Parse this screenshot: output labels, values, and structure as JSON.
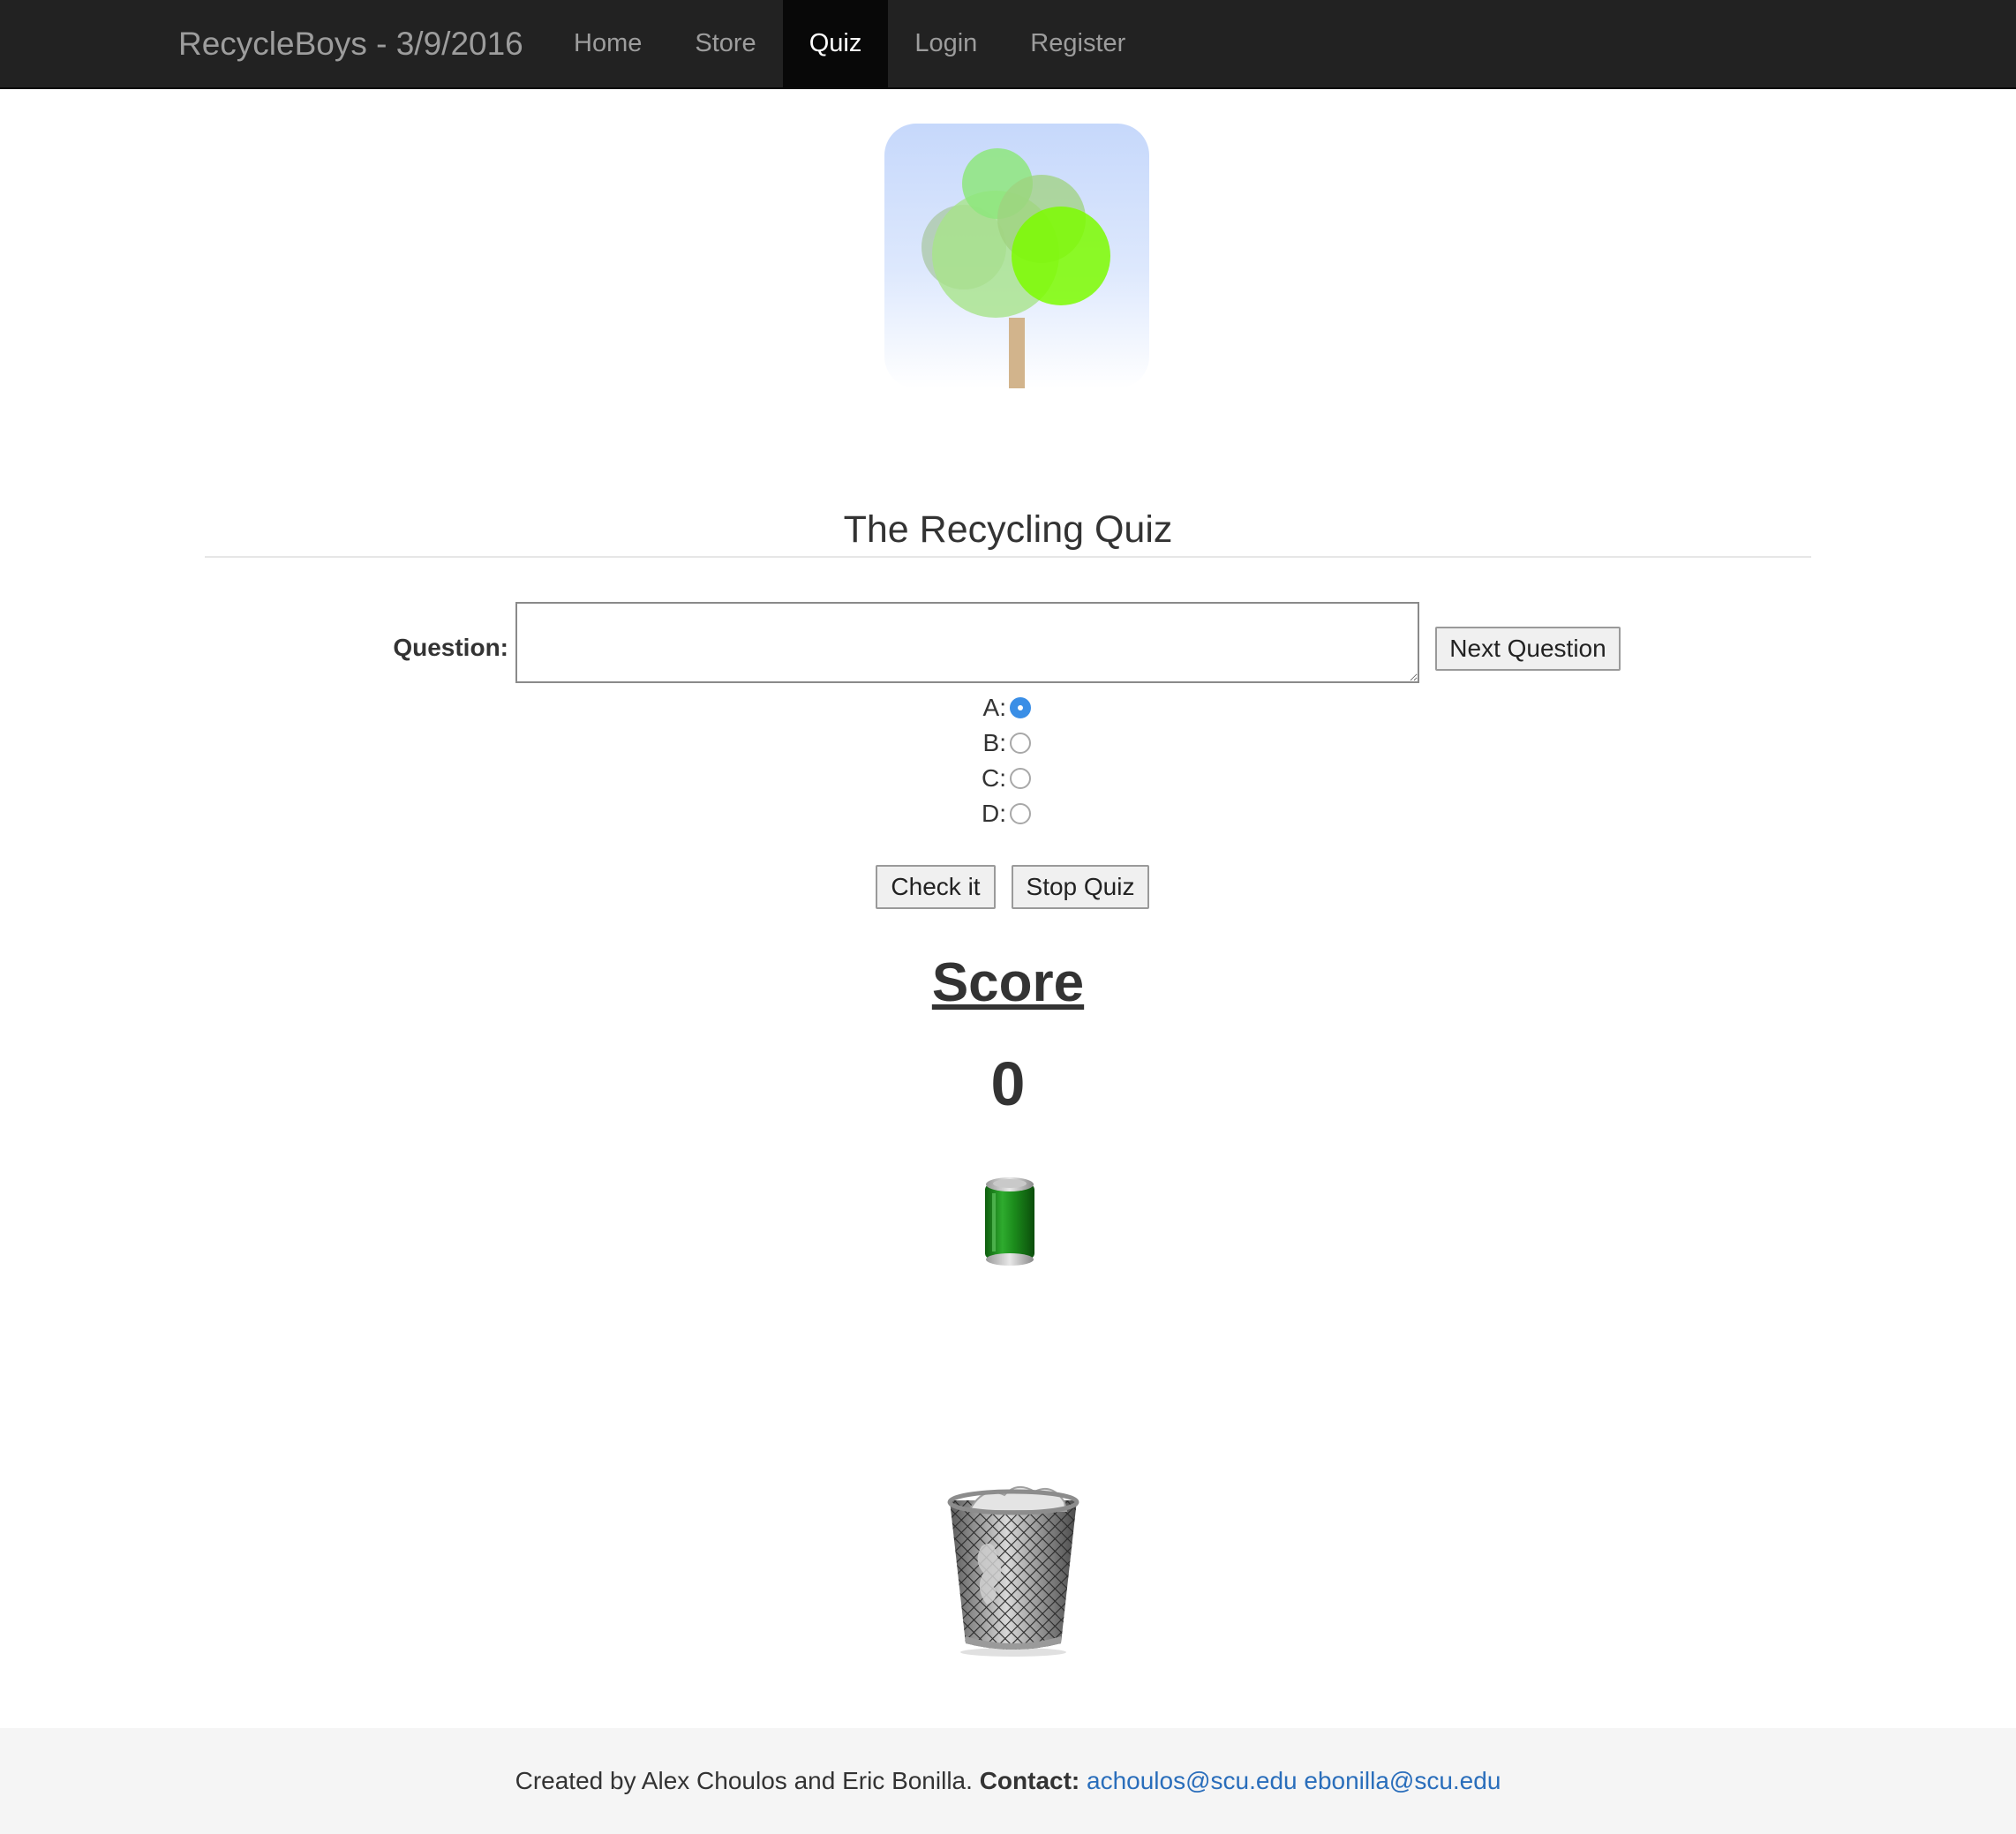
{
  "navbar": {
    "brand": "RecycleBoys - 3/9/2016",
    "items": [
      {
        "label": "Home",
        "active": false
      },
      {
        "label": "Store",
        "active": false
      },
      {
        "label": "Quiz",
        "active": true
      },
      {
        "label": "Login",
        "active": false
      },
      {
        "label": "Register",
        "active": false
      }
    ]
  },
  "logo": {
    "icon": "tree-logo-icon"
  },
  "quiz": {
    "title": "The Recycling Quiz",
    "question_label": "Question:",
    "question_value": "",
    "next_button": "Next Question",
    "options": [
      {
        "label": "A:",
        "checked": true
      },
      {
        "label": "B:",
        "checked": false
      },
      {
        "label": "C:",
        "checked": false
      },
      {
        "label": "D:",
        "checked": false
      }
    ],
    "check_button": "Check it",
    "stop_button": "Stop Quiz"
  },
  "score": {
    "heading": "Score",
    "value": "0"
  },
  "images": {
    "can_icon": "green-can-icon",
    "bin_icon": "recycle-bin-icon"
  },
  "footer": {
    "created_by": "Created by Alex Choulos and Eric Bonilla.",
    "contact_label": "Contact:",
    "emails": [
      "achoulos@scu.edu",
      "ebonilla@scu.edu"
    ]
  },
  "colors": {
    "navbar_bg": "#222222",
    "navbar_active_bg": "#080808",
    "link": "#2a6ebb",
    "radio_checked": "#3a8ee6",
    "can_green": "#1f8a1f"
  }
}
